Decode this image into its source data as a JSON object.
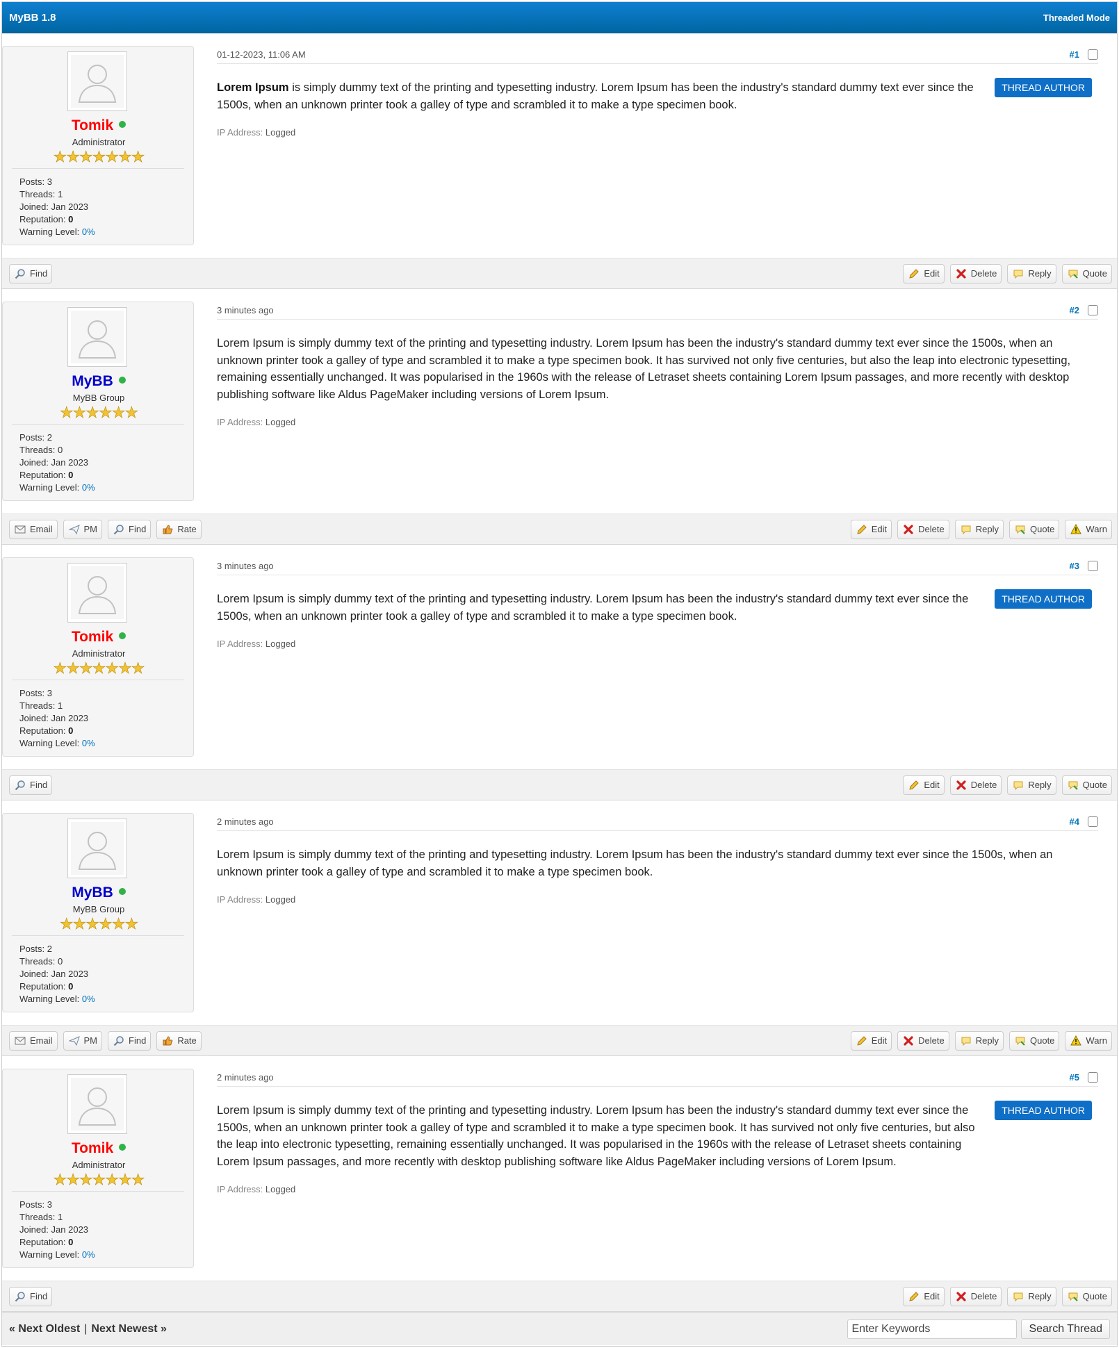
{
  "header": {
    "title": "MyBB 1.8",
    "mode": "Threaded Mode"
  },
  "colors": {
    "admin": "#ff0000",
    "group": "#0000cc",
    "accent": "#0072bc"
  },
  "labels": {
    "ip_label": "IP Address:",
    "ip_value": "Logged",
    "thread_author": "THREAD AUTHOR",
    "posts": "Posts:",
    "threads": "Threads:",
    "joined": "Joined:",
    "reputation": "Reputation:",
    "warning": "Warning Level:"
  },
  "buttons": {
    "find": "Find",
    "email": "Email",
    "pm": "PM",
    "rate": "Rate",
    "edit": "Edit",
    "delete": "Delete",
    "reply": "Reply",
    "quote": "Quote",
    "warn": "Warn"
  },
  "posts": [
    {
      "number": "#1",
      "date": "01-12-2023, 11:06 AM",
      "user": {
        "name": "Tomik",
        "title": "Administrator",
        "stars": "★★★★★★★",
        "posts": "3",
        "threads": "1",
        "joined": "Jan 2023",
        "reputation": "0",
        "warning": "0%"
      },
      "lead": "Lorem Ipsum",
      "text": " is simply dummy text of the printing and typesetting industry. Lorem Ipsum has been the industry's standard dummy text ever since the 1500s, when an unknown printer took a galley of type and scrambled it to make a type specimen book."
    },
    {
      "number": "#2",
      "date": "3 minutes ago",
      "user": {
        "name": "MyBB",
        "title": "MyBB Group",
        "stars": "★★★★★★",
        "posts": "2",
        "threads": "0",
        "joined": "Jan 2023",
        "reputation": "0",
        "warning": "0%"
      },
      "lead": "",
      "text": "Lorem Ipsum is simply dummy text of the printing and typesetting industry. Lorem Ipsum has been the industry's standard dummy text ever since the 1500s, when an unknown printer took a galley of type and scrambled it to make a type specimen book. It has survived not only five centuries, but also the leap into electronic typesetting, remaining essentially unchanged. It was popularised in the 1960s with the release of Letraset sheets containing Lorem Ipsum passages, and more recently with desktop publishing software like Aldus PageMaker including versions of Lorem Ipsum."
    },
    {
      "number": "#3",
      "date": "3 minutes ago",
      "user": {
        "name": "Tomik",
        "title": "Administrator",
        "stars": "★★★★★★★",
        "posts": "3",
        "threads": "1",
        "joined": "Jan 2023",
        "reputation": "0",
        "warning": "0%"
      },
      "lead": "",
      "text": "Lorem Ipsum is simply dummy text of the printing and typesetting industry. Lorem Ipsum has been the industry's standard dummy text ever since the 1500s, when an unknown printer took a galley of type and scrambled it to make a type specimen book."
    },
    {
      "number": "#4",
      "date": "2 minutes ago",
      "user": {
        "name": "MyBB",
        "title": "MyBB Group",
        "stars": "★★★★★★",
        "posts": "2",
        "threads": "0",
        "joined": "Jan 2023",
        "reputation": "0",
        "warning": "0%"
      },
      "lead": "",
      "text": "Lorem Ipsum is simply dummy text of the printing and typesetting industry. Lorem Ipsum has been the industry's standard dummy text ever since the 1500s, when an unknown printer took a galley of type and scrambled it to make a type specimen book."
    },
    {
      "number": "#5",
      "date": "2 minutes ago",
      "user": {
        "name": "Tomik",
        "title": "Administrator",
        "stars": "★★★★★★★",
        "posts": "3",
        "threads": "1",
        "joined": "Jan 2023",
        "reputation": "0",
        "warning": "0%"
      },
      "lead": "",
      "text": "Lorem Ipsum is simply dummy text of the printing and typesetting industry. Lorem Ipsum has been the industry's standard dummy text ever since the 1500s, when an unknown printer took a galley of type and scrambled it to make a type specimen book. It has survived not only five centuries, but also the leap into electronic typesetting, remaining essentially unchanged. It was popularised in the 1960s with the release of Letraset sheets containing Lorem Ipsum passages, and more recently with desktop publishing software like Aldus PageMaker including versions of Lorem Ipsum."
    }
  ],
  "footer": {
    "prev": "« Next Oldest",
    "sep": "|",
    "next": "Next Newest »",
    "search_placeholder": "Enter Keywords",
    "search_button": "Search Thread"
  }
}
